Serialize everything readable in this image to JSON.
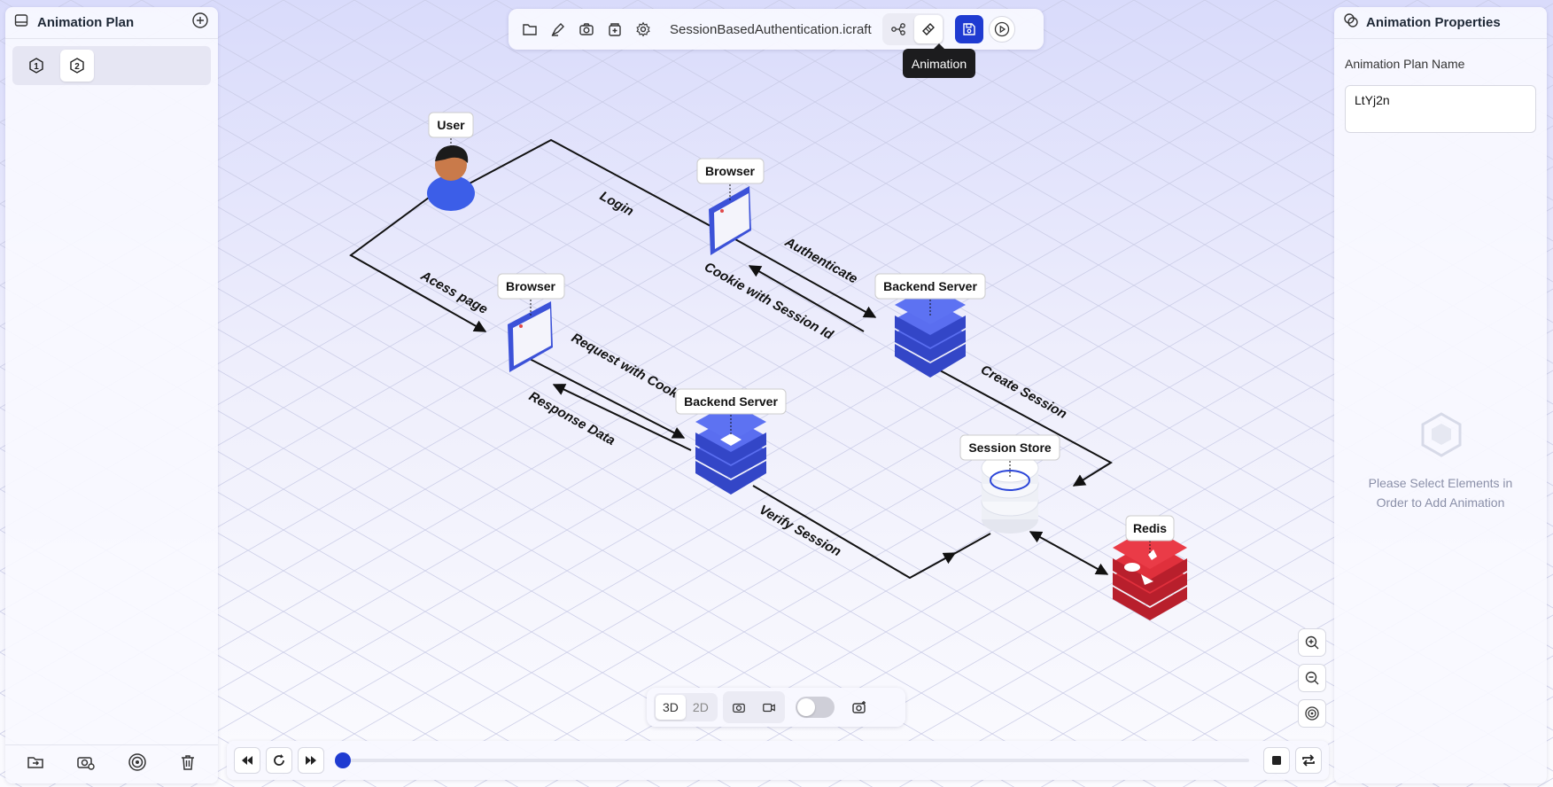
{
  "left_panel": {
    "title": "Animation Plan",
    "plans": [
      {
        "label": "1"
      },
      {
        "label": "2"
      }
    ]
  },
  "right_panel": {
    "title": "Animation Properties",
    "name_label": "Animation Plan Name",
    "name_value": "LtYj2n",
    "empty_text_line1": "Please Select Elements in",
    "empty_text_line2": "Order to Add Animation"
  },
  "toolbar": {
    "filename": "SessionBasedAuthentication.icraft",
    "tooltip": "Animation"
  },
  "view_toolbar": {
    "mode_3d": "3D",
    "mode_2d": "2D"
  },
  "diagram": {
    "nodes": {
      "user": "User",
      "browser_top": "Browser",
      "browser_left": "Browser",
      "backend_top": "Backend Server",
      "backend_bottom": "Backend Server",
      "session_store": "Session Store",
      "redis": "Redis"
    },
    "edges": {
      "login": "Login",
      "authenticate": "Authenticate",
      "cookie": "Cookie with Session Id",
      "create_session": "Create Session",
      "access_page": "Acess page",
      "request_cookie": "Request with Cookie",
      "response_data": "Response Data",
      "verify_session": "Verify Session"
    }
  },
  "colors": {
    "accent": "#1f3bd1",
    "server_blue": "#4a5ee8",
    "redis_red": "#e0303c"
  }
}
